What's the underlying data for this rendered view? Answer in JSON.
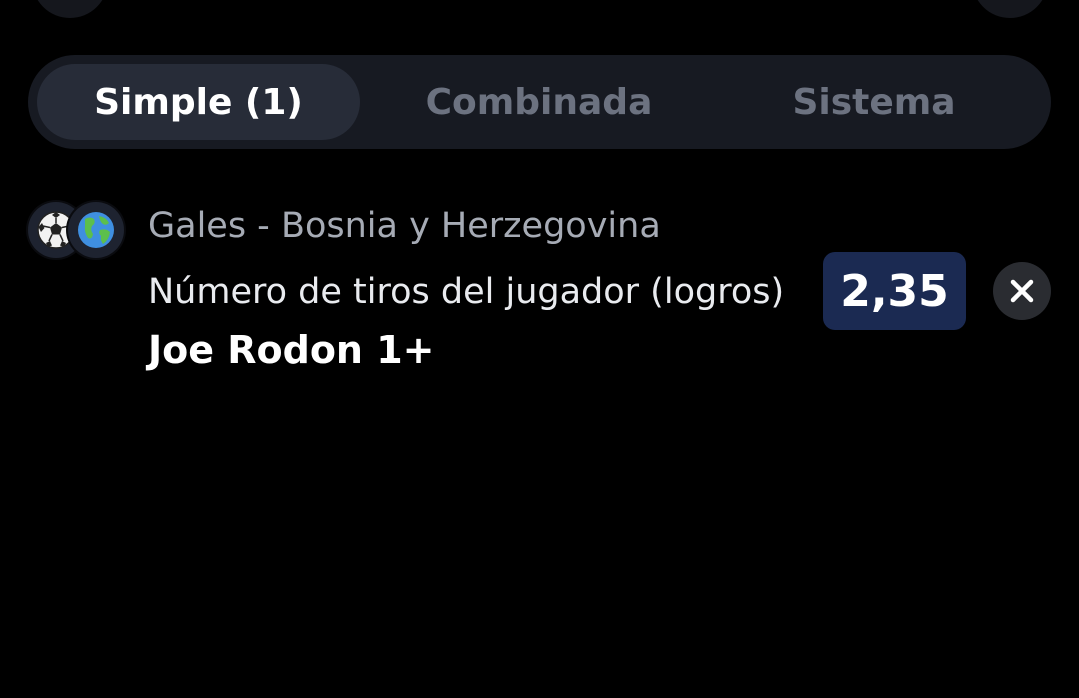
{
  "top_controls": {
    "left_button_icon": "back-icon",
    "right_button_icon": "menu-icon"
  },
  "tabs": [
    {
      "label": "Simple (1)",
      "active": true
    },
    {
      "label": "Combinada",
      "active": false
    },
    {
      "label": "Sistema",
      "active": false
    }
  ],
  "bet": {
    "sport_icon": "soccer-ball-icon",
    "region_icon": "globe-icon",
    "event": "Gales - Bosnia y Herzegovina",
    "market": "Número de tiros del jugador (logros)",
    "selection": "Joe Rodon 1+",
    "odds": "2,35",
    "remove_icon": "close-icon"
  },
  "colors": {
    "background": "#000000",
    "tabs_track": "#171a22",
    "tab_active": "#272c38",
    "tab_inactive_text": "#6c7280",
    "odds_badge": "#1b2a52",
    "remove_button": "#2a2c31"
  }
}
